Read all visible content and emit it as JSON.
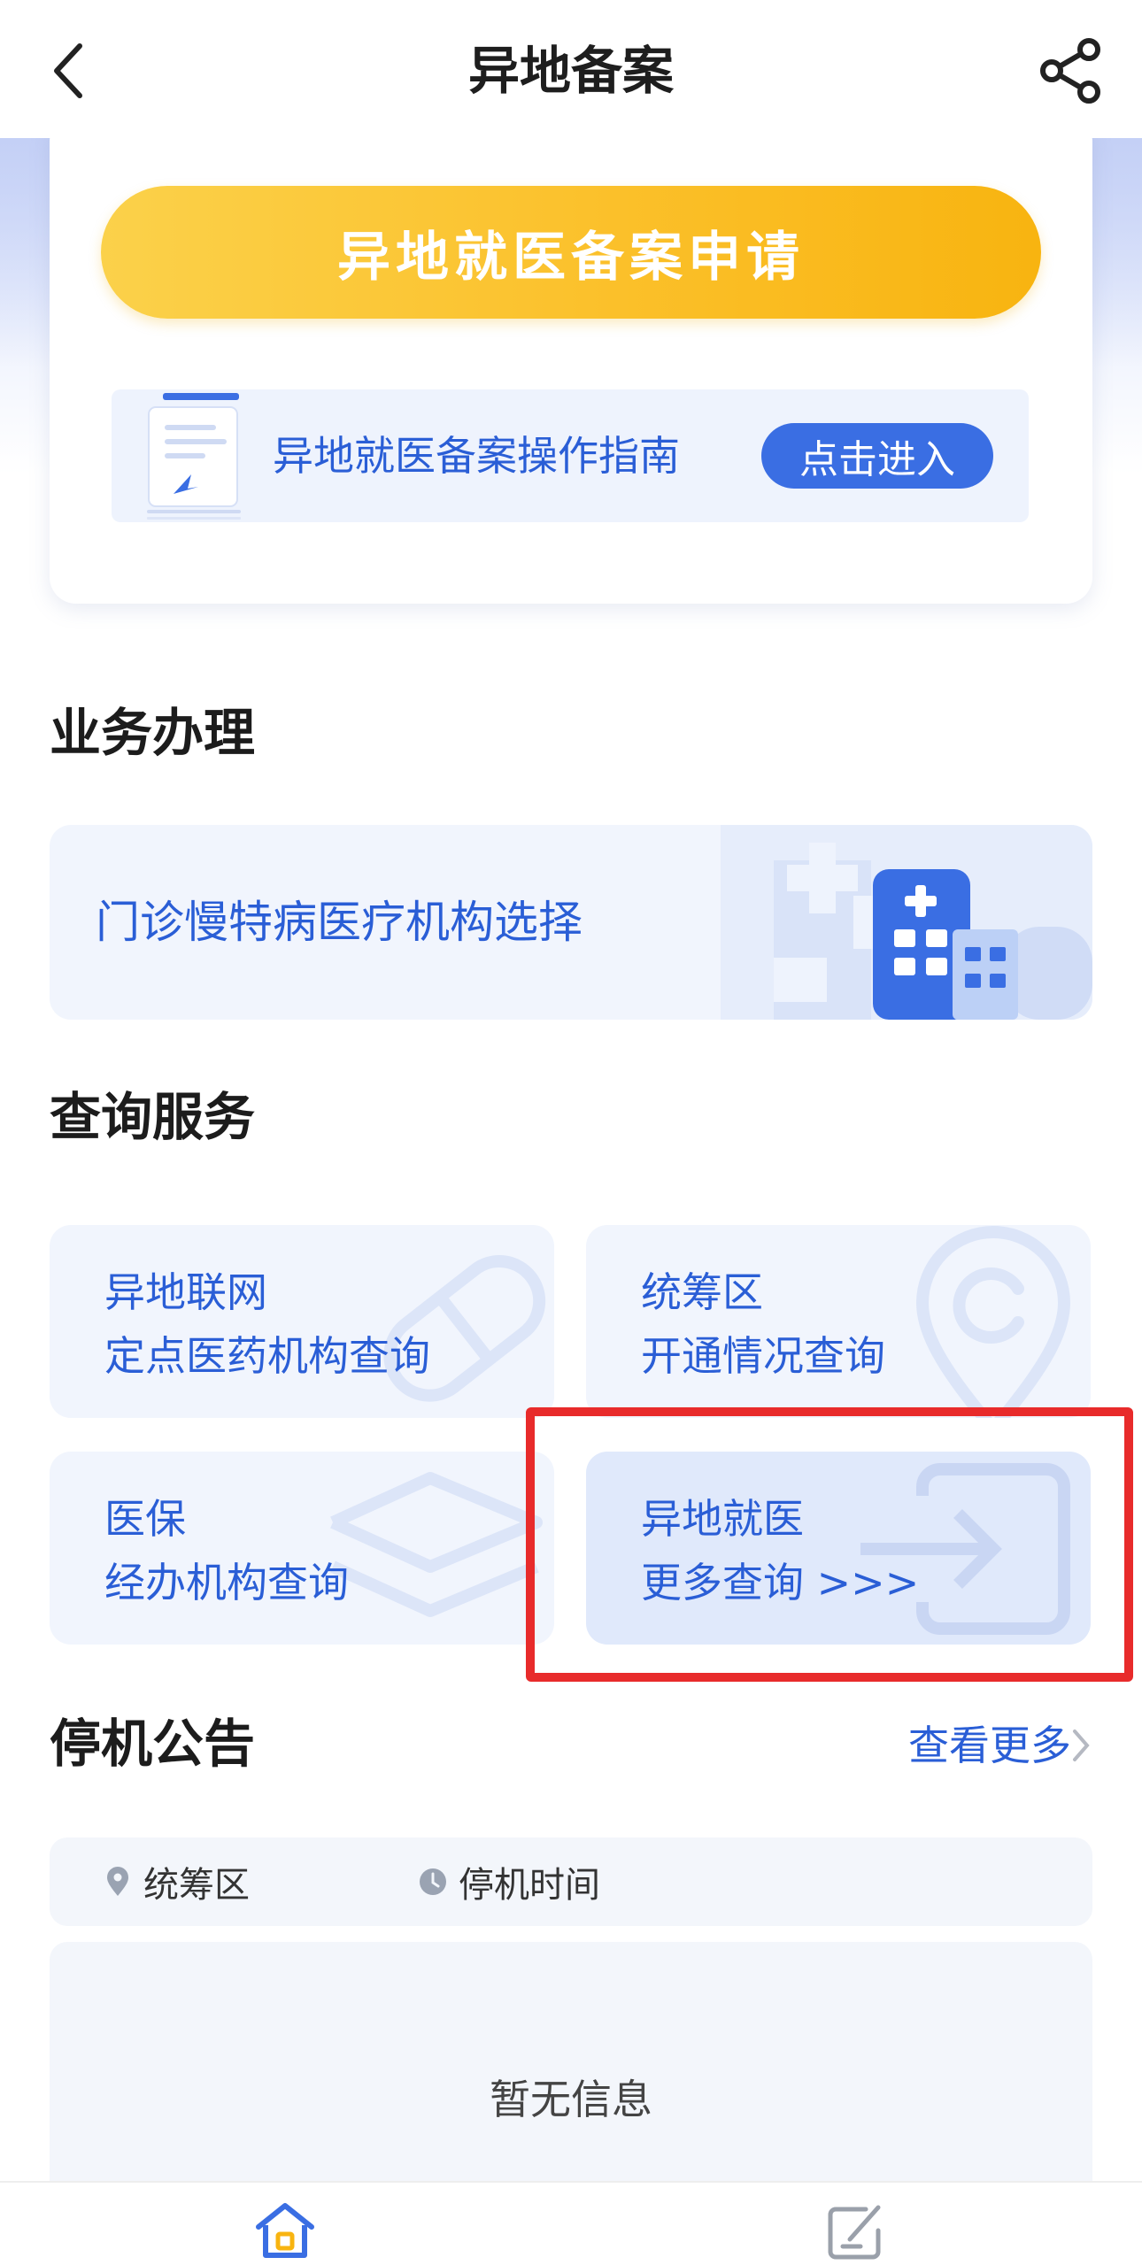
{
  "header": {
    "title": "异地备案",
    "back_icon": "chevron-left-icon",
    "share_icon": "share-icon"
  },
  "top_card": {
    "apply_label": "异地就医备案申请",
    "guide_text": "异地就医备案操作指南",
    "guide_button": "点击进入"
  },
  "business": {
    "title": "业务办理",
    "item_label": "门诊慢特病医疗机构选择"
  },
  "query": {
    "title": "查询服务",
    "items": [
      {
        "line1": "异地联网",
        "line2": "定点医药机构查询"
      },
      {
        "line1": "统筹区",
        "line2": "开通情况查询"
      },
      {
        "line1": "医保",
        "line2": "经办机构查询"
      },
      {
        "line1": "异地就医",
        "line2": "更多查询 >>>"
      }
    ]
  },
  "notice": {
    "title": "停机公告",
    "more_label": "查看更多",
    "col_region": "统筹区",
    "col_time": "停机时间",
    "empty_text": "暂无信息"
  },
  "colors": {
    "accent_blue": "#2a5ed6",
    "button_yellow": "#fbc02a",
    "highlight_red": "#e82b2b"
  }
}
